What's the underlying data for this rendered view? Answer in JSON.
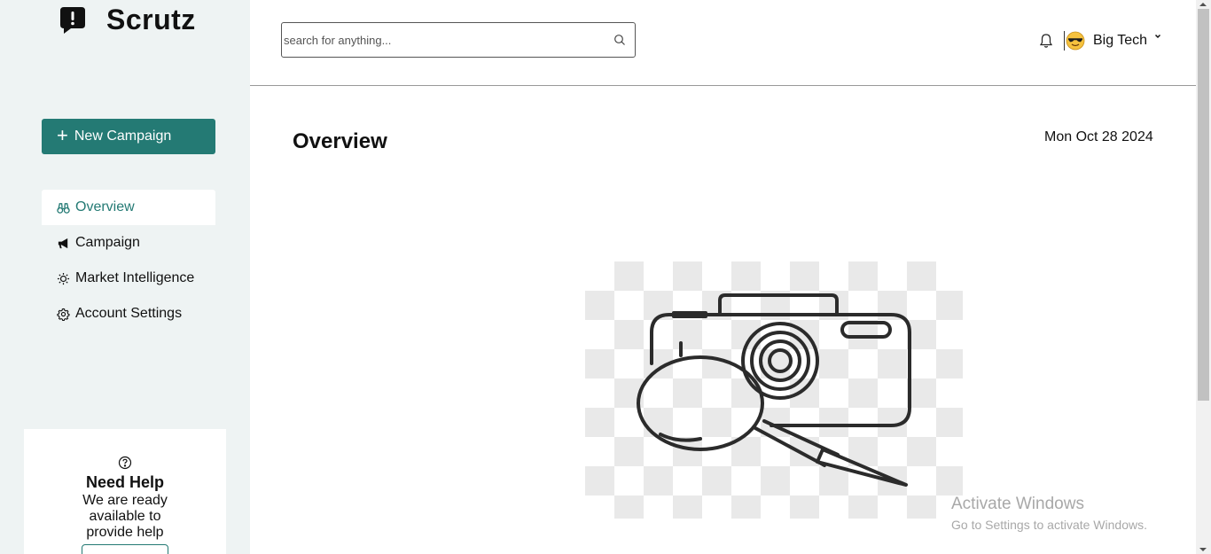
{
  "brand": {
    "name": "Scrutz",
    "icon": "chat-alert-icon"
  },
  "sidebar": {
    "new_campaign_label": "New Campaign",
    "items": [
      {
        "label": "Overview",
        "icon": "binoculars-icon",
        "active": true
      },
      {
        "label": "Campaign",
        "icon": "megaphone-icon",
        "active": false
      },
      {
        "label": "Market Intelligence",
        "icon": "lightbulb-icon",
        "active": false
      },
      {
        "label": "Account Settings",
        "icon": "gear-icon",
        "active": false
      }
    ],
    "help": {
      "icon": "question-circle-icon",
      "title": "Need Help",
      "text": "We are ready available to provide help"
    }
  },
  "header": {
    "search_placeholder": "search for anything...",
    "user_name": "Big Tech",
    "avatar": "sunglasses-emoji-avatar"
  },
  "main": {
    "title": "Overview",
    "date": "Mon Oct 28 2024",
    "image": "image-placeholder-icon"
  },
  "watermark": {
    "title": "Activate Windows",
    "subtitle": "Go to Settings to activate Windows."
  },
  "colors": {
    "accent": "#247a74",
    "sidebar_bg": "#eef3f3"
  }
}
